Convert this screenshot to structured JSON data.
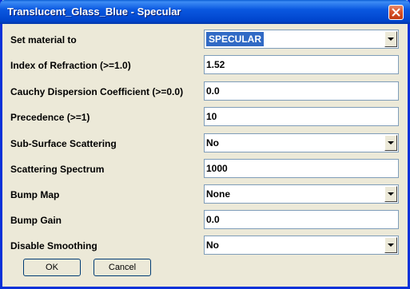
{
  "window": {
    "title": "Translucent_Glass_Blue - Specular"
  },
  "form": {
    "rows": [
      {
        "label": "Set material to",
        "value": "SPECULAR",
        "kind": "select"
      },
      {
        "label": "Index of Refraction (>=1.0)",
        "value": "1.52",
        "kind": "text"
      },
      {
        "label": "Cauchy Dispersion Coefficient (>=0.0)",
        "value": "0.0",
        "kind": "text"
      },
      {
        "label": "Precedence (>=1)",
        "value": "10",
        "kind": "text"
      },
      {
        "label": "Sub-Surface Scattering",
        "value": "No",
        "kind": "select"
      },
      {
        "label": "Scattering Spectrum",
        "value": "1000",
        "kind": "text"
      },
      {
        "label": "Bump Map",
        "value": "None",
        "kind": "select"
      },
      {
        "label": "Bump Gain",
        "value": "0.0",
        "kind": "text"
      },
      {
        "label": "Disable Smoothing",
        "value": "No",
        "kind": "select"
      }
    ]
  },
  "buttons": {
    "ok": "OK",
    "cancel": "Cancel"
  },
  "colors": {
    "titlebar": "#0a58e0",
    "dialog_bg": "#ece9d8",
    "selection": "#316ac5"
  },
  "icons": {
    "close": "close-icon",
    "dropdown": "chevron-down-icon"
  }
}
